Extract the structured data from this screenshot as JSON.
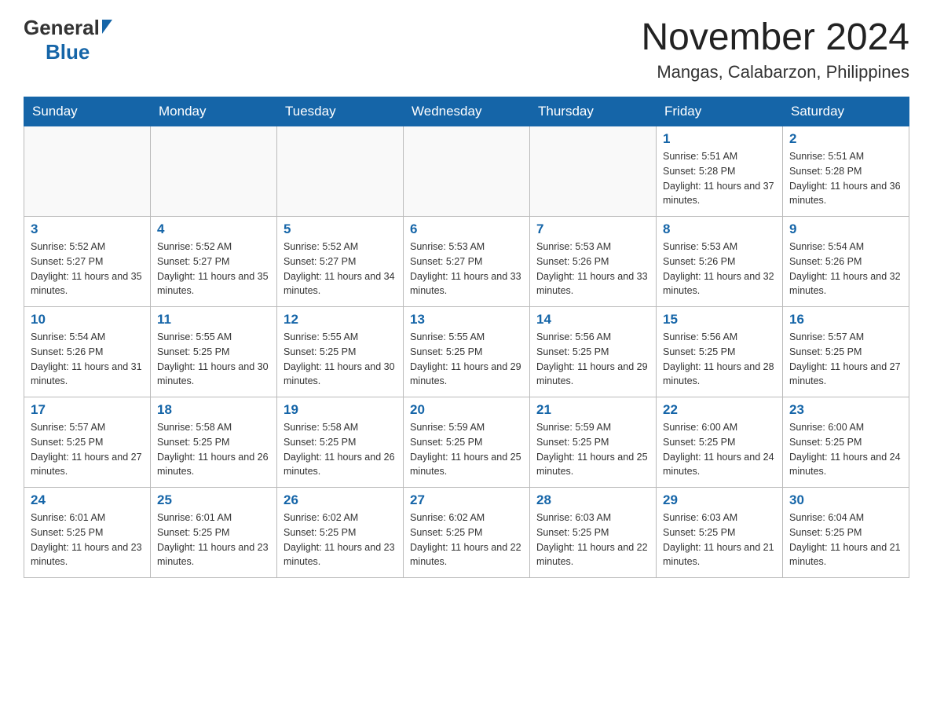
{
  "header": {
    "month_title": "November 2024",
    "subtitle": "Mangas, Calabarzon, Philippines"
  },
  "logo": {
    "general": "General",
    "blue": "Blue"
  },
  "days_of_week": [
    "Sunday",
    "Monday",
    "Tuesday",
    "Wednesday",
    "Thursday",
    "Friday",
    "Saturday"
  ],
  "weeks": [
    [
      {
        "day": "",
        "info": ""
      },
      {
        "day": "",
        "info": ""
      },
      {
        "day": "",
        "info": ""
      },
      {
        "day": "",
        "info": ""
      },
      {
        "day": "",
        "info": ""
      },
      {
        "day": "1",
        "info": "Sunrise: 5:51 AM\nSunset: 5:28 PM\nDaylight: 11 hours and 37 minutes."
      },
      {
        "day": "2",
        "info": "Sunrise: 5:51 AM\nSunset: 5:28 PM\nDaylight: 11 hours and 36 minutes."
      }
    ],
    [
      {
        "day": "3",
        "info": "Sunrise: 5:52 AM\nSunset: 5:27 PM\nDaylight: 11 hours and 35 minutes."
      },
      {
        "day": "4",
        "info": "Sunrise: 5:52 AM\nSunset: 5:27 PM\nDaylight: 11 hours and 35 minutes."
      },
      {
        "day": "5",
        "info": "Sunrise: 5:52 AM\nSunset: 5:27 PM\nDaylight: 11 hours and 34 minutes."
      },
      {
        "day": "6",
        "info": "Sunrise: 5:53 AM\nSunset: 5:27 PM\nDaylight: 11 hours and 33 minutes."
      },
      {
        "day": "7",
        "info": "Sunrise: 5:53 AM\nSunset: 5:26 PM\nDaylight: 11 hours and 33 minutes."
      },
      {
        "day": "8",
        "info": "Sunrise: 5:53 AM\nSunset: 5:26 PM\nDaylight: 11 hours and 32 minutes."
      },
      {
        "day": "9",
        "info": "Sunrise: 5:54 AM\nSunset: 5:26 PM\nDaylight: 11 hours and 32 minutes."
      }
    ],
    [
      {
        "day": "10",
        "info": "Sunrise: 5:54 AM\nSunset: 5:26 PM\nDaylight: 11 hours and 31 minutes."
      },
      {
        "day": "11",
        "info": "Sunrise: 5:55 AM\nSunset: 5:25 PM\nDaylight: 11 hours and 30 minutes."
      },
      {
        "day": "12",
        "info": "Sunrise: 5:55 AM\nSunset: 5:25 PM\nDaylight: 11 hours and 30 minutes."
      },
      {
        "day": "13",
        "info": "Sunrise: 5:55 AM\nSunset: 5:25 PM\nDaylight: 11 hours and 29 minutes."
      },
      {
        "day": "14",
        "info": "Sunrise: 5:56 AM\nSunset: 5:25 PM\nDaylight: 11 hours and 29 minutes."
      },
      {
        "day": "15",
        "info": "Sunrise: 5:56 AM\nSunset: 5:25 PM\nDaylight: 11 hours and 28 minutes."
      },
      {
        "day": "16",
        "info": "Sunrise: 5:57 AM\nSunset: 5:25 PM\nDaylight: 11 hours and 27 minutes."
      }
    ],
    [
      {
        "day": "17",
        "info": "Sunrise: 5:57 AM\nSunset: 5:25 PM\nDaylight: 11 hours and 27 minutes."
      },
      {
        "day": "18",
        "info": "Sunrise: 5:58 AM\nSunset: 5:25 PM\nDaylight: 11 hours and 26 minutes."
      },
      {
        "day": "19",
        "info": "Sunrise: 5:58 AM\nSunset: 5:25 PM\nDaylight: 11 hours and 26 minutes."
      },
      {
        "day": "20",
        "info": "Sunrise: 5:59 AM\nSunset: 5:25 PM\nDaylight: 11 hours and 25 minutes."
      },
      {
        "day": "21",
        "info": "Sunrise: 5:59 AM\nSunset: 5:25 PM\nDaylight: 11 hours and 25 minutes."
      },
      {
        "day": "22",
        "info": "Sunrise: 6:00 AM\nSunset: 5:25 PM\nDaylight: 11 hours and 24 minutes."
      },
      {
        "day": "23",
        "info": "Sunrise: 6:00 AM\nSunset: 5:25 PM\nDaylight: 11 hours and 24 minutes."
      }
    ],
    [
      {
        "day": "24",
        "info": "Sunrise: 6:01 AM\nSunset: 5:25 PM\nDaylight: 11 hours and 23 minutes."
      },
      {
        "day": "25",
        "info": "Sunrise: 6:01 AM\nSunset: 5:25 PM\nDaylight: 11 hours and 23 minutes."
      },
      {
        "day": "26",
        "info": "Sunrise: 6:02 AM\nSunset: 5:25 PM\nDaylight: 11 hours and 23 minutes."
      },
      {
        "day": "27",
        "info": "Sunrise: 6:02 AM\nSunset: 5:25 PM\nDaylight: 11 hours and 22 minutes."
      },
      {
        "day": "28",
        "info": "Sunrise: 6:03 AM\nSunset: 5:25 PM\nDaylight: 11 hours and 22 minutes."
      },
      {
        "day": "29",
        "info": "Sunrise: 6:03 AM\nSunset: 5:25 PM\nDaylight: 11 hours and 21 minutes."
      },
      {
        "day": "30",
        "info": "Sunrise: 6:04 AM\nSunset: 5:25 PM\nDaylight: 11 hours and 21 minutes."
      }
    ]
  ]
}
